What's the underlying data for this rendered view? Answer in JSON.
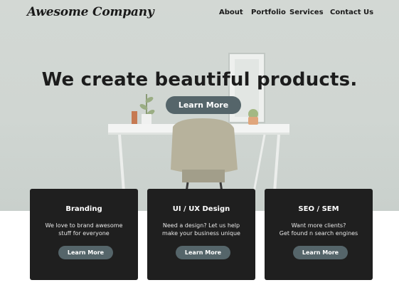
{
  "header": {
    "logo_text": "Awesome Company",
    "nav": [
      "About",
      "Portfolio",
      "Services",
      "Contact Us"
    ]
  },
  "hero": {
    "headline": "We create beautiful products.",
    "cta_label": "Learn More"
  },
  "services": [
    {
      "title": "Branding",
      "description": "We love to brand awesome\nstuff for everyone",
      "button_label": "Learn More"
    },
    {
      "title": "UI / UX Design",
      "description": "Need a design? Let us help\nmake your business unique",
      "button_label": "Learn More"
    },
    {
      "title": "SEO / SEM",
      "description": "Want more clients?\nGet found n search engines",
      "button_label": "Learn More"
    }
  ],
  "colors": {
    "button": "#55656a",
    "card_background": "#1f1f1f",
    "hero_background": "#d3d8d4",
    "text_dark": "#1c1c1c"
  }
}
